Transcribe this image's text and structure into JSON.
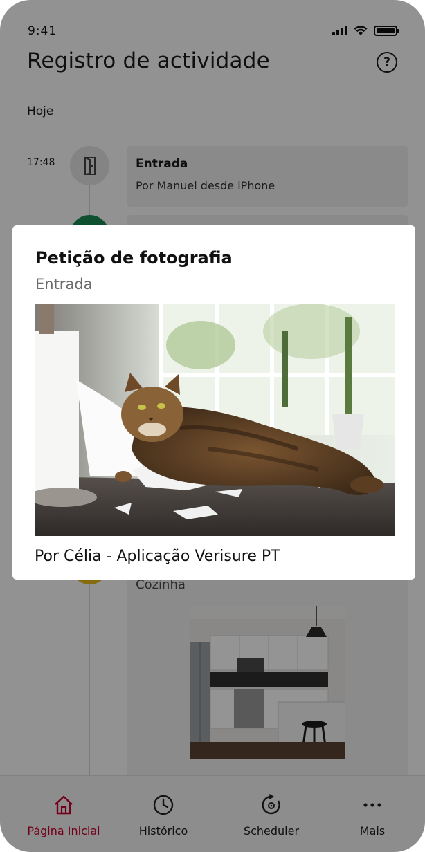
{
  "status_bar": {
    "time": "9:41",
    "signal_icon": "signal-icon",
    "wifi_icon": "wifi-icon",
    "battery_icon": "battery-icon"
  },
  "header": {
    "title": "Registro de actividade",
    "help_icon": "help-icon",
    "help_glyph": "?"
  },
  "section": {
    "label": "Hoje"
  },
  "timeline": {
    "events": [
      {
        "time": "17:48",
        "icon": "door-icon",
        "title": "Entrada",
        "subtitle": "Por Manuel desde iPhone"
      }
    ],
    "photo_card": {
      "location": "Cozinha",
      "image": "kitchen-photo"
    }
  },
  "modal": {
    "title": "Petição de fotografia",
    "subtitle": "Entrada",
    "image": "cat-on-counter-photo",
    "footer": "Por Célia - Aplicação Verisure PT"
  },
  "bottom_nav": {
    "items": [
      {
        "label": "Página Inicial",
        "icon": "home-icon",
        "active": true
      },
      {
        "label": "Histórico",
        "icon": "clock-icon",
        "active": false
      },
      {
        "label": "Scheduler",
        "icon": "scheduler-icon",
        "active": false
      },
      {
        "label": "Mais",
        "icon": "more-icon",
        "active": false
      }
    ]
  },
  "colors": {
    "accent": "#c4002a",
    "green": "#1b8a55",
    "yellow": "#e8b81a"
  }
}
